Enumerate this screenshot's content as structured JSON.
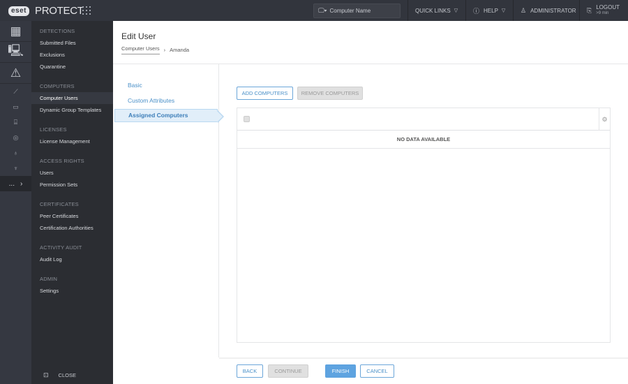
{
  "topbar": {
    "logo_badge": "eset",
    "product": "PROTECT",
    "search_placeholder": "Computer Name",
    "quick_links": "QUICK LINKS",
    "help": "HELP",
    "user": "ADMINISTRATOR",
    "logout": "LOGOUT",
    "logout_timer": ">9 min"
  },
  "rail": {
    "icons": [
      "dashboard-icon",
      "computers-icon",
      "detections-icon",
      "reports-icon",
      "tasks-icon",
      "installers-icon",
      "policies-icon",
      "notifications-icon",
      "status-overview-icon"
    ],
    "more": "..."
  },
  "nav": {
    "sections": [
      {
        "title": "DETECTIONS",
        "items": [
          "Submitted Files",
          "Exclusions",
          "Quarantine"
        ]
      },
      {
        "title": "COMPUTERS",
        "items": [
          "Computer Users",
          "Dynamic Group Templates"
        ]
      },
      {
        "title": "LICENSES",
        "items": [
          "License Management"
        ]
      },
      {
        "title": "ACCESS RIGHTS",
        "items": [
          "Users",
          "Permission Sets"
        ]
      },
      {
        "title": "CERTIFICATES",
        "items": [
          "Peer Certificates",
          "Certification Authorities"
        ]
      },
      {
        "title": "ACTIVITY AUDIT",
        "items": [
          "Audit Log"
        ]
      },
      {
        "title": "ADMIN",
        "items": [
          "Settings"
        ]
      }
    ],
    "active": "Computer Users",
    "close": "CLOSE"
  },
  "page": {
    "title": "Edit User",
    "breadcrumb": [
      "Computer Users",
      "Amanda"
    ]
  },
  "wizard": {
    "steps": [
      "Basic",
      "Custom Attributes",
      "Assigned Computers"
    ],
    "active_step": "Assigned Computers"
  },
  "content": {
    "add_button": "ADD COMPUTERS",
    "remove_button": "REMOVE COMPUTERS",
    "empty_message": "NO DATA AVAILABLE"
  },
  "footer": {
    "back": "BACK",
    "continue": "CONTINUE",
    "finish": "FINISH",
    "cancel": "CANCEL"
  }
}
